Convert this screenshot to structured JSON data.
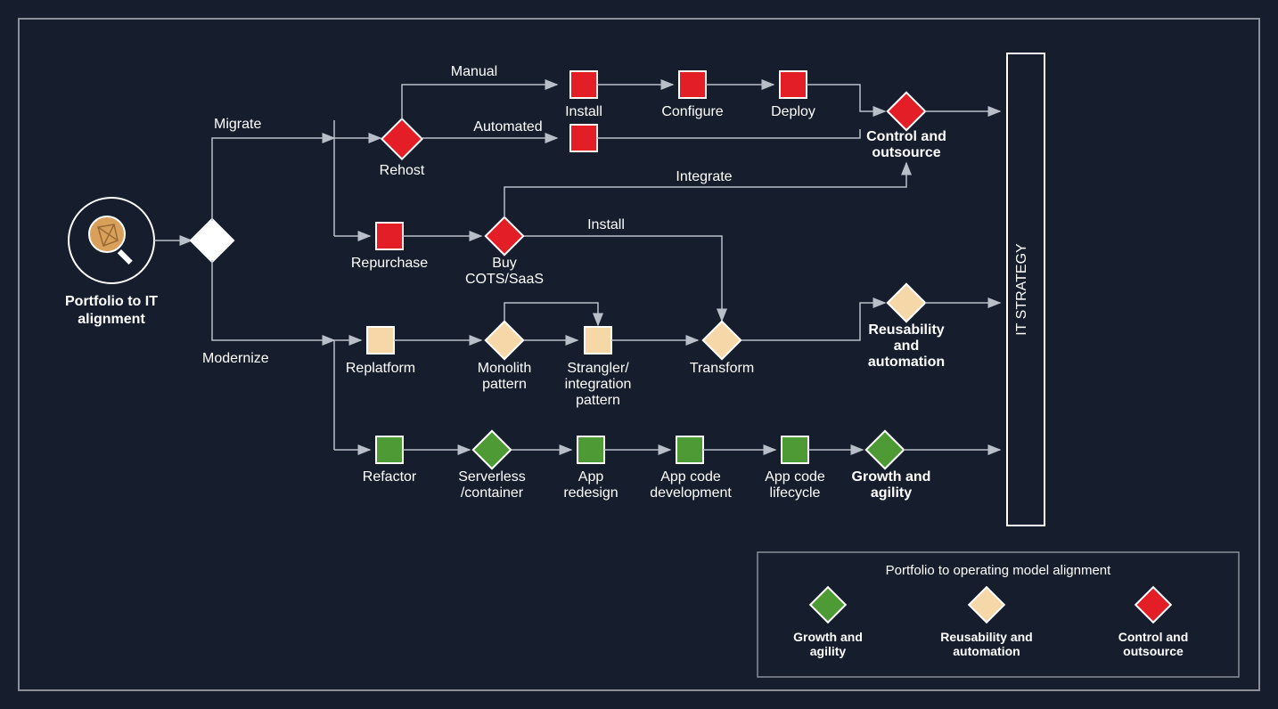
{
  "colors": {
    "red": "#e41e26",
    "tan": "#f6d7a7",
    "green": "#4e9b36",
    "white": "#ffffff",
    "bg": "#161E2D"
  },
  "start": {
    "title1": "Portfolio to IT",
    "title2": "alignment"
  },
  "branches": {
    "migrate": "Migrate",
    "modernize": "Modernize"
  },
  "migrate": {
    "rehost": "Rehost",
    "manual": "Manual",
    "automated": "Automated",
    "install": "Install",
    "configure": "Configure",
    "deploy": "Deploy",
    "repurchase": "Repurchase",
    "buy1": "Buy",
    "buy2": "COTS/SaaS",
    "integrate": "Integrate",
    "install2": "Install",
    "out1": "Control and",
    "out2": "outsource"
  },
  "modernize": {
    "replatform": "Replatform",
    "mono1": "Monolith",
    "mono2": "pattern",
    "str1": "Strangler/",
    "str2": "integration",
    "str3": "pattern",
    "transform": "Transform",
    "out1": "Reusability",
    "out2": "and",
    "out3": "automation",
    "refactor": "Refactor",
    "srv1": "Serverless",
    "srv2": "/container",
    "app1": "App",
    "app2": "redesign",
    "dev1": "App code",
    "dev2": "development",
    "lc1": "App code",
    "lc2": "lifecycle",
    "out4": "Growth and",
    "out5": "agility"
  },
  "itstrategy": "IT STRATEGY",
  "legend": {
    "title": "Portfolio to operating model alignment",
    "g1": "Growth and",
    "g2": "agility",
    "r1": "Reusability and",
    "r2": "automation",
    "c1": "Control and",
    "c2": "outsource"
  }
}
